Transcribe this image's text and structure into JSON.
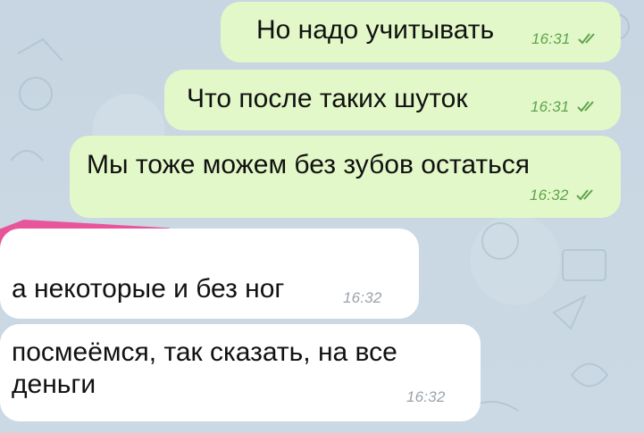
{
  "colors": {
    "wallpaper": "#c9d7e3",
    "outgoing_bubble": "#e3f8c8",
    "incoming_bubble": "#ffffff",
    "outgoing_time": "#5ea34d",
    "incoming_time": "#9aa3ab",
    "redaction": "#ea4b95"
  },
  "messages": [
    {
      "direction": "outgoing",
      "text": "Но надо учитывать",
      "time": "16:31",
      "status_icon": "double-check-icon"
    },
    {
      "direction": "outgoing",
      "text": "Что после таких шуток",
      "time": "16:31",
      "status_icon": "double-check-icon"
    },
    {
      "direction": "outgoing",
      "text": "Мы тоже можем без зубов остаться",
      "time": "16:32",
      "status_icon": "double-check-icon"
    },
    {
      "direction": "incoming",
      "text": "а некоторые и без ног",
      "time": "16:32"
    },
    {
      "direction": "incoming",
      "text": "посмеёмся, так сказать, на все деньги",
      "time": "16:32"
    }
  ]
}
